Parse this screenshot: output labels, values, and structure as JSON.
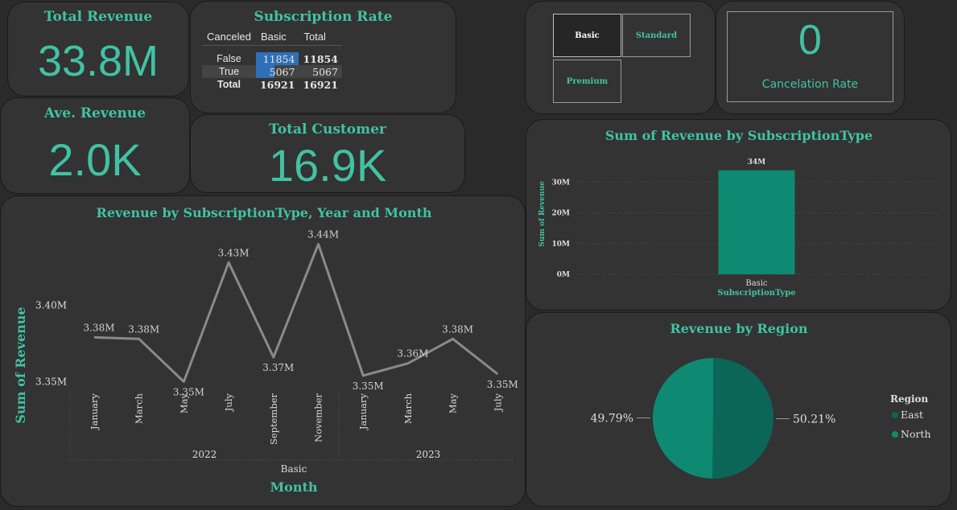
{
  "colors": {
    "accent": "#41c2a4",
    "bar": "#0e8a72",
    "pie_north": "#0e8a72",
    "pie_east": "#0c6658",
    "line": "#8a8a8a",
    "background": "#2a2a2a",
    "card": "#333333"
  },
  "total_revenue": {
    "title": "Total Revenue",
    "value": "33.8M"
  },
  "ave_revenue": {
    "title": "Ave. Revenue",
    "value": "2.0K"
  },
  "total_customer": {
    "title": "Total Customer",
    "value": "16.9K"
  },
  "subscription_rate": {
    "title": "Subscription Rate",
    "headers": [
      "Canceled",
      "Basic",
      "Total"
    ],
    "rows": [
      {
        "label": "False",
        "basic": "11854",
        "total": "11854",
        "bar_fraction": 1.0
      },
      {
        "label": "True",
        "basic": "5067",
        "total": "5067",
        "bar_fraction": 0.4275
      },
      {
        "label": "Total",
        "basic": "16921",
        "total": "16921",
        "bar_fraction": 0
      }
    ]
  },
  "slicer": {
    "options": [
      "Basic",
      "Standard",
      "Premium"
    ],
    "selected": "Basic"
  },
  "cancelation": {
    "value": "0",
    "label": "Cancelation Rate"
  },
  "chart_data": [
    {
      "type": "line",
      "title": "Revenue by SubscriptionType, Year and Month",
      "ylabel": "Sum of Revenue",
      "xlabel": "Month",
      "series_group_label": "Basic",
      "years": [
        {
          "label": "2022",
          "months": [
            "January",
            "March",
            "May",
            "July",
            "September",
            "November"
          ]
        },
        {
          "label": "2023",
          "months": [
            "January",
            "March",
            "May",
            "July"
          ]
        }
      ],
      "x": [
        "January",
        "March",
        "May",
        "July",
        "September",
        "November",
        "January",
        "March",
        "May",
        "July"
      ],
      "values": [
        3.379,
        3.378,
        3.35,
        3.428,
        3.366,
        3.44,
        3.354,
        3.362,
        3.378,
        3.355
      ],
      "data_labels": [
        "3.38M",
        "3.38M",
        "3.35M",
        "3.43M",
        "3.37M",
        "3.44M",
        "3.35M",
        "3.36M",
        "3.38M",
        "3.35M"
      ],
      "y_ticks": [
        3.35,
        3.4
      ],
      "y_tick_labels": [
        "3.35M",
        "3.40M"
      ],
      "ylim": [
        3.345,
        3.445
      ],
      "unit": "M"
    },
    {
      "type": "bar",
      "title": "Sum of Revenue by SubscriptionType",
      "categories": [
        "Basic"
      ],
      "values": [
        33.8
      ],
      "data_labels": [
        "34M"
      ],
      "xlabel": "SubscriptionType",
      "ylabel": "Sum of Revenue",
      "y_ticks": [
        0,
        10,
        20,
        30
      ],
      "y_tick_labels": [
        "0M",
        "10M",
        "20M",
        "30M"
      ],
      "ylim": [
        0,
        34
      ],
      "grid": true
    },
    {
      "type": "pie",
      "title": "Revenue by Region",
      "legend_title": "Region",
      "slices": [
        {
          "name": "East",
          "value": 50.21,
          "label": "50.21%"
        },
        {
          "name": "North",
          "value": 49.79,
          "label": "49.79%"
        }
      ],
      "legend_placement": "right"
    }
  ]
}
